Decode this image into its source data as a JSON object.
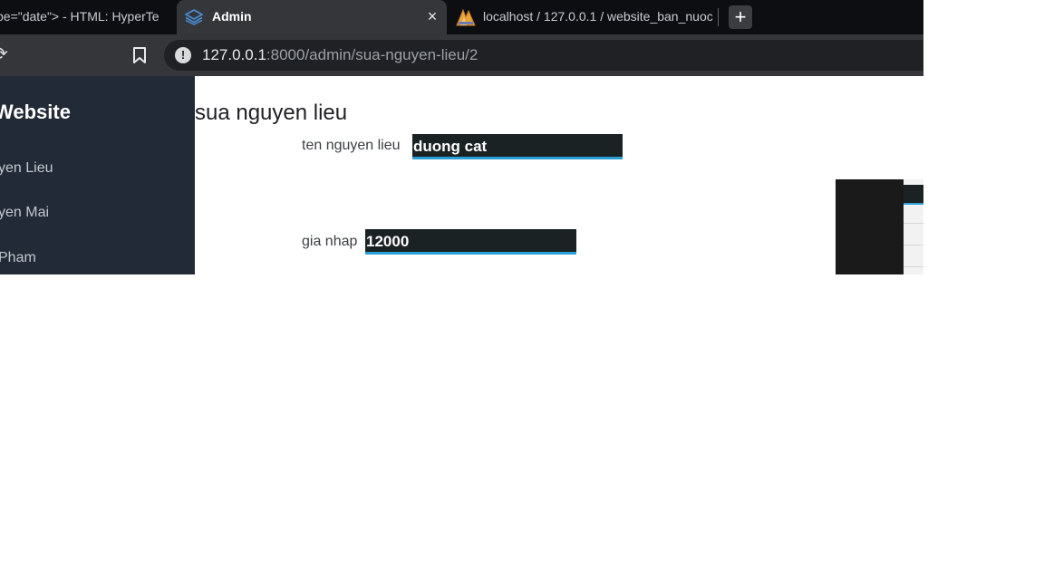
{
  "browser": {
    "tabs": [
      {
        "title": "pe=\"date\"> - HTML: HyperTe"
      },
      {
        "title": "Admin"
      },
      {
        "title": "localhost / 127.0.0.1 / website_ban_nuoc"
      }
    ],
    "new_tab_label": "+",
    "close_label": "×",
    "url": {
      "host": "127.0.0.1",
      "rest": ":8000/admin/sua-nguyen-lieu/2"
    },
    "info_label": "!"
  },
  "sidebar": {
    "brand": "Website",
    "items": [
      {
        "label": "yen Lieu"
      },
      {
        "label": "yen Mai"
      },
      {
        "label": "Pham"
      }
    ]
  },
  "form": {
    "title": "sua nguyen lieu",
    "ten_label": "ten nguyen lieu",
    "ten_value": "duong cat",
    "gia_label": "gia nhap",
    "gia_value": "12000"
  },
  "colors": {
    "accent": "#2a9fd6",
    "sidebar": "#212a36",
    "field": "#1b2224"
  }
}
